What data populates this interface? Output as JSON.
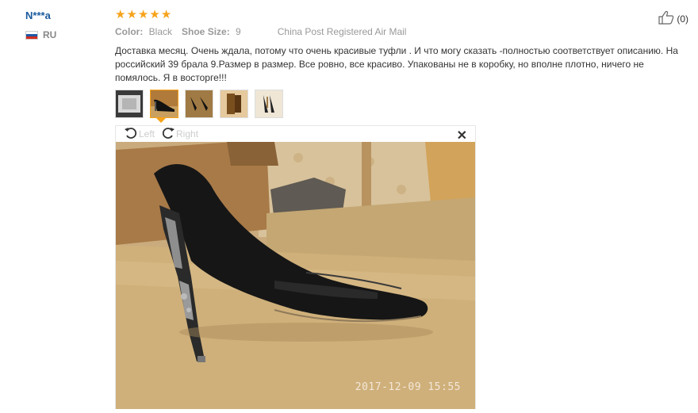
{
  "reviewer": {
    "name": "N***a",
    "country": "RU"
  },
  "rating": {
    "stars": 5,
    "max": 5
  },
  "product_meta": {
    "color_label": "Color:",
    "color_value": "Black",
    "size_label": "Shoe Size:",
    "size_value": "9",
    "shipping": "China Post Registered Air Mail"
  },
  "helpful": {
    "count": "(0)"
  },
  "review_text": "Доставка месяц. Очень ждала, потому что очень красивые туфли . И что могу сказать -полностью соответствует описанию. На российский 39 брала 9.Размер в размер. Все ровно, все красиво. Упакованы не в коробку, но вполне плотно, ничего не помялось. Я в восторге!!!",
  "photo_viewer": {
    "rotate_left_label": "Left",
    "rotate_right_label": "Right",
    "timestamp": "2017-12-09 15:55"
  },
  "colors": {
    "star": "#f7a31b",
    "name": "#1a5a9e"
  }
}
